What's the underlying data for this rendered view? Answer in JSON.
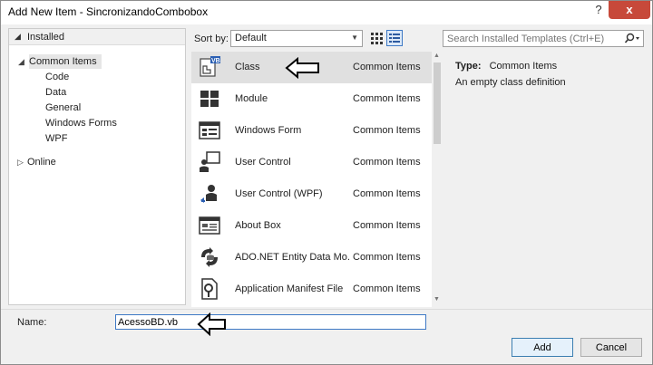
{
  "window": {
    "title": "Add New Item - SincronizandoCombobox",
    "help_label": "?",
    "close_label": "x"
  },
  "left": {
    "installed_label": "Installed",
    "tree": [
      {
        "label": "Common Items"
      },
      {
        "label": "Code"
      },
      {
        "label": "Data"
      },
      {
        "label": "General"
      },
      {
        "label": "Windows Forms"
      },
      {
        "label": "WPF"
      },
      {
        "label": "Online"
      }
    ]
  },
  "toolbar": {
    "sort_label": "Sort by:",
    "sort_value": "Default",
    "search_placeholder": "Search Installed Templates (Ctrl+E)"
  },
  "templates": [
    {
      "name": "Class",
      "category": "Common Items",
      "icon": "class-vb-icon"
    },
    {
      "name": "Module",
      "category": "Common Items",
      "icon": "module-icon"
    },
    {
      "name": "Windows Form",
      "category": "Common Items",
      "icon": "windows-form-icon"
    },
    {
      "name": "User Control",
      "category": "Common Items",
      "icon": "user-control-icon"
    },
    {
      "name": "User Control (WPF)",
      "category": "Common Items",
      "icon": "user-control-wpf-icon"
    },
    {
      "name": "About Box",
      "category": "Common Items",
      "icon": "about-box-icon"
    },
    {
      "name": "ADO.NET Entity Data Mo...",
      "category": "Common Items",
      "icon": "entity-data-model-icon"
    },
    {
      "name": "Application Manifest File",
      "category": "Common Items",
      "icon": "manifest-icon"
    }
  ],
  "details": {
    "type_label": "Type:",
    "type_value": "Common Items",
    "description": "An empty class definition"
  },
  "bottom": {
    "name_label": "Name:",
    "name_value": "AcessoBD.vb",
    "add_label": "Add",
    "cancel_label": "Cancel"
  },
  "colors": {
    "selection": "#e0e0e0",
    "accent": "#3e79c5",
    "close": "#c7493a"
  }
}
